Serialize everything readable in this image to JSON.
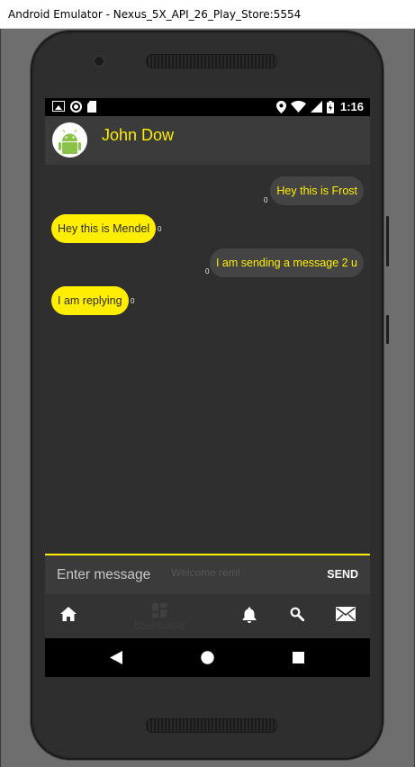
{
  "window": {
    "title": "Android Emulator - Nexus_5X_API_26_Play_Store:5554"
  },
  "statusbar": {
    "time": "1:16"
  },
  "chat": {
    "contact_name": "John Dow",
    "messages": [
      {
        "direction": "sent",
        "text": "Hey this is Frost",
        "count": "0"
      },
      {
        "direction": "received",
        "text": "Hey this is Mendel",
        "count": "0"
      },
      {
        "direction": "sent",
        "text": "I am sending a message 2 u",
        "count": "0"
      },
      {
        "direction": "received",
        "text": "I am replying",
        "count": "0"
      }
    ]
  },
  "composer": {
    "placeholder": "Enter message",
    "background_text": "Welcome rem!",
    "send_label": "SEND"
  },
  "bottom_nav": {
    "items": [
      {
        "icon": "home-icon",
        "label": ""
      },
      {
        "icon": "dashboard-icon",
        "label": "Dashboard"
      },
      {
        "icon": "bell-icon",
        "label": ""
      },
      {
        "icon": "search-icon",
        "label": ""
      },
      {
        "icon": "mail-icon",
        "label": ""
      }
    ]
  },
  "colors": {
    "accent": "#ffee00",
    "sent_bubble": "#444444",
    "received_bubble": "#ffee00",
    "screen_background": "#2f2f2f",
    "app_bar": "#3b3b3b"
  }
}
